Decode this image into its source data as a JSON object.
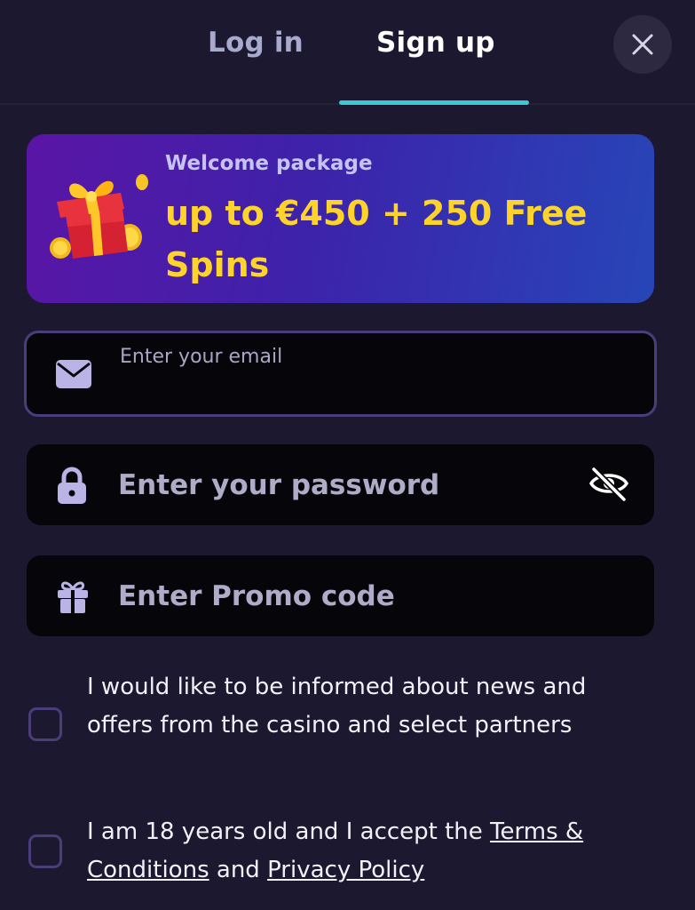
{
  "tabs": {
    "login": "Log in",
    "signup": "Sign up"
  },
  "banner": {
    "subtitle": "Welcome package",
    "title": "up to €450 + 250 Free Spins"
  },
  "email": {
    "label": "Enter your email",
    "value": ""
  },
  "password": {
    "placeholder": "Enter your password"
  },
  "promo": {
    "placeholder": "Enter Promo code"
  },
  "consents": {
    "news": "I would like to be informed about news and offers from the casino and select partners",
    "age_prefix": "I am 18 years old and I accept the ",
    "terms_link": "Terms & Conditions",
    "and": " and ",
    "privacy_link": "Privacy Policy"
  },
  "colors": {
    "background": "#1c1830",
    "accent_tab": "#3cc9d6",
    "banner_highlight": "#ffd42a",
    "input_bg": "#06060a",
    "icon": "#b9b3e6"
  },
  "icons": {
    "close": "close-icon",
    "gift_banner": "gift-box-coins-icon",
    "email": "envelope-icon",
    "password": "lock-icon",
    "toggle_visibility": "eye-off-icon",
    "promo": "gift-icon"
  }
}
